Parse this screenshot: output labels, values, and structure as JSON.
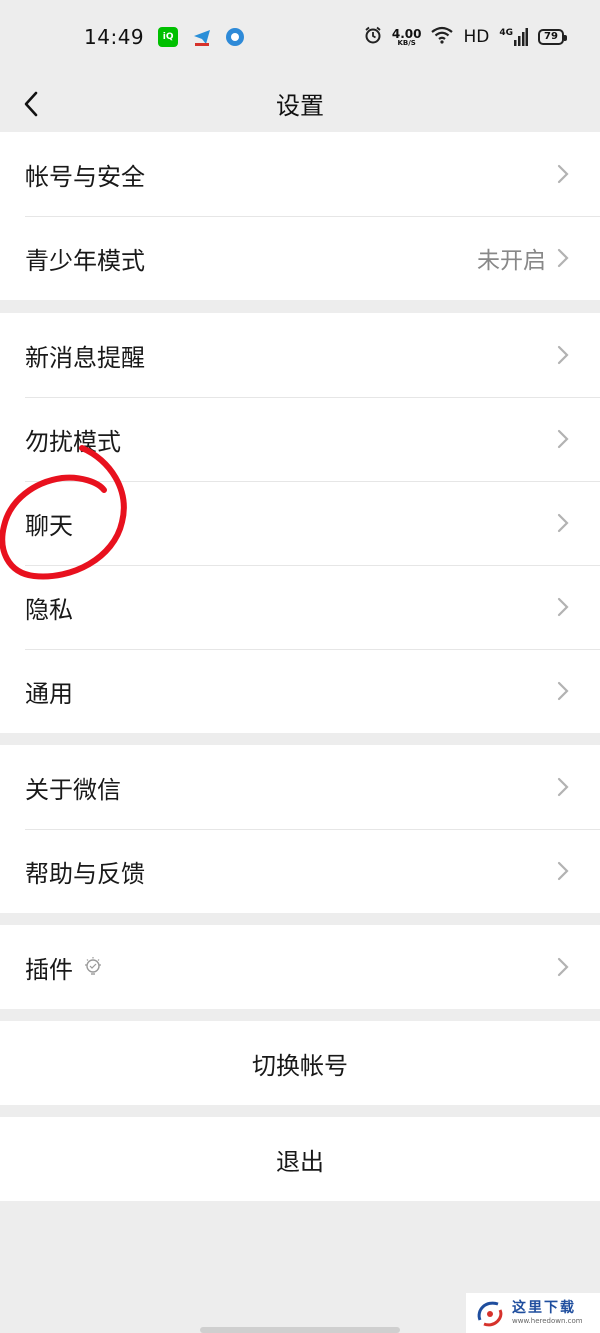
{
  "status_bar": {
    "time": "14:49",
    "net_speed_value": "4.00",
    "net_speed_unit": "KB/S",
    "hd_label": "HD",
    "signal_label": "4G",
    "battery_level": "79",
    "icons": [
      "iqiyi-app-icon",
      "telegram-app-icon",
      "browser-app-icon",
      "alarm-icon",
      "wifi-icon",
      "signal-icon",
      "battery-icon"
    ]
  },
  "nav": {
    "title": "设置",
    "back_icon": "chevron-left-icon"
  },
  "groups": [
    {
      "items": [
        {
          "label": "帐号与安全",
          "value": ""
        },
        {
          "label": "青少年模式",
          "value": "未开启"
        }
      ]
    },
    {
      "items": [
        {
          "label": "新消息提醒",
          "value": ""
        },
        {
          "label": "勿扰模式",
          "value": ""
        },
        {
          "label": "聊天",
          "value": ""
        },
        {
          "label": "隐私",
          "value": ""
        },
        {
          "label": "通用",
          "value": ""
        }
      ]
    },
    {
      "items": [
        {
          "label": "关于微信",
          "value": ""
        },
        {
          "label": "帮助与反馈",
          "value": ""
        }
      ]
    },
    {
      "items": [
        {
          "label": "插件",
          "value": ""
        }
      ]
    }
  ],
  "actions": {
    "switch_account": "切换帐号",
    "logout": "退出"
  },
  "annotation": {
    "color": "#e8111e",
    "target": "聊天"
  },
  "watermark": {
    "text": "这里下载",
    "url": "www.heredown.com"
  },
  "colors": {
    "background": "#ededed",
    "card": "#ffffff",
    "text": "#191919",
    "secondary_text": "#888888",
    "chevron": "#b2b2b2"
  }
}
